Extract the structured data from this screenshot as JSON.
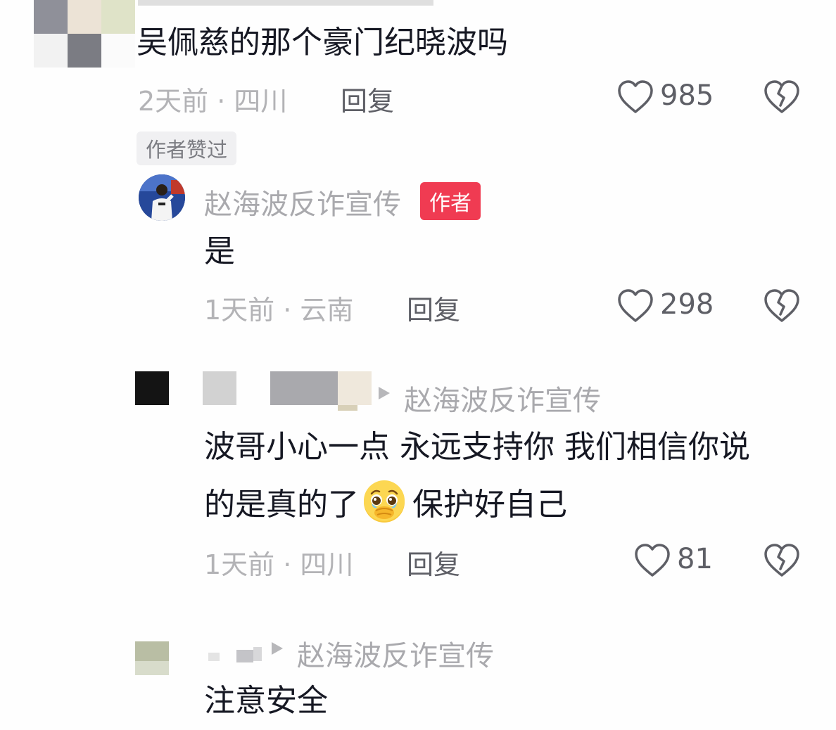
{
  "comments": [
    {
      "text": "吴佩慈的那个豪门纪晓波吗",
      "time_location": "2天前 · 四川",
      "reply_label": "回复",
      "likes": "985",
      "badge": "作者赞过"
    },
    {
      "author": "赵海波反诈宣传",
      "author_badge": "作者",
      "text": "是",
      "time_location": "1天前 · 云南",
      "reply_label": "回复",
      "likes": "298"
    },
    {
      "reply_to": "赵海波反诈宣传",
      "text_line1": "波哥小心一点 永远支持你 我们相信你说",
      "text_line2_a": "的是真的了",
      "text_line2_b": "保护好自己",
      "time_location": "1天前 · 四川",
      "reply_label": "回复",
      "likes": "81"
    },
    {
      "reply_to": "赵海波反诈宣传",
      "text": "注意安全"
    }
  ],
  "icons": {
    "like": "heart-outline-icon",
    "dislike": "broken-heart-icon",
    "reply_arrow": "triangle-right-icon",
    "emoji": "holding-back-tears-emoji"
  },
  "colors": {
    "author_badge": "#f03b52",
    "text": "#161823",
    "meta": "#b3b3b6"
  }
}
